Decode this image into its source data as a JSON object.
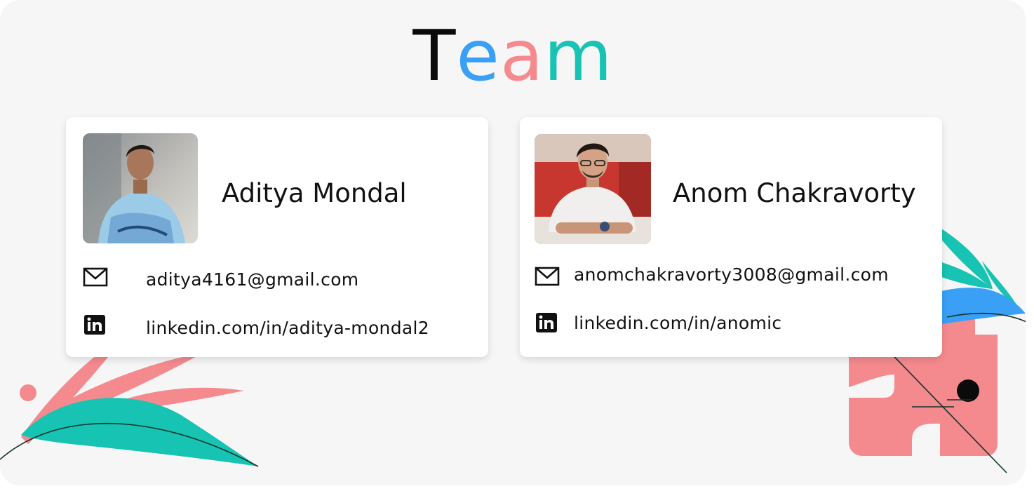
{
  "page": {
    "title_letters": [
      "T",
      "e",
      "a",
      "m"
    ],
    "title_colors": [
      "#0a0a0a",
      "#3aa0f5",
      "#f48a8e",
      "#17c3b2"
    ]
  },
  "team": [
    {
      "name": "Aditya Mondal",
      "email": "aditya4161@gmail.com",
      "linkedin": "linkedin.com/in/aditya-mondal2"
    },
    {
      "name": "Anom Chakravorty",
      "email": "anomchakravorty3008@gmail.com",
      "linkedin": "linkedin.com/in/anomic"
    }
  ],
  "icons": {
    "email": "mail-icon",
    "linkedin": "linkedin-icon"
  },
  "colors": {
    "teal": "#17c3b2",
    "coral": "#f48a8e",
    "blue": "#3aa0f5"
  }
}
